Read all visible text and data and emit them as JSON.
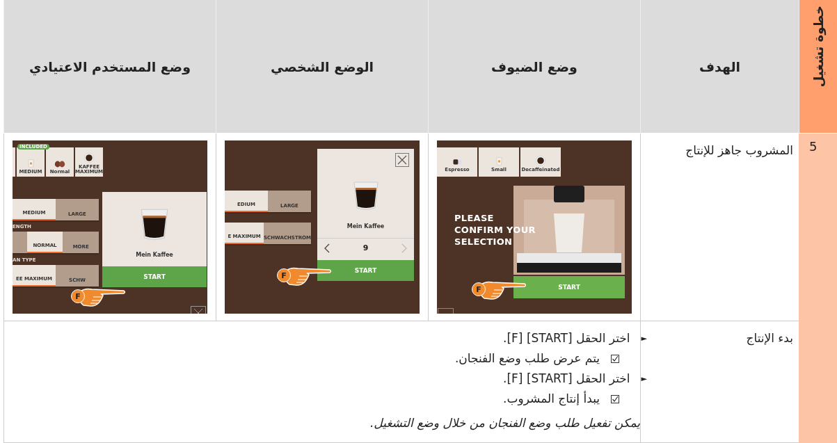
{
  "table": {
    "header": {
      "step": "خطوة تشغيل",
      "goal": "الهدف",
      "modes": [
        "وضع الضيوف",
        "الوضع الشخصي",
        "وضع المستخدم الاعتيادي"
      ]
    },
    "rows": [
      {
        "kind": "screens",
        "step": "5",
        "goal": "المشروب جاهز للإنتاج",
        "screens": [
          {
            "kind": "guest",
            "tiles": [
              {
                "label": "Espresso"
              },
              {
                "label": "Small"
              },
              {
                "label": "Decaffeinated"
              }
            ],
            "prompt": [
              "PLEASE",
              "CONFIRM YOUR",
              "SELECTION"
            ],
            "button": "START",
            "badge": "F"
          },
          {
            "kind": "personal",
            "groups": [
              {
                "options": [
                  {
                    "label": "EDIUM",
                    "selected": true
                  },
                  {
                    "label": "LARGE",
                    "selected": false
                  }
                ]
              },
              {
                "options": [
                  {
                    "label": "E MAXIMUM",
                    "selected": true
                  },
                  {
                    "label": "SCHWACHSTROM",
                    "selected": false
                  }
                ]
              }
            ],
            "product": "Mein Kaffee",
            "counter": "9",
            "button": "START",
            "badge": "F"
          },
          {
            "kind": "standard",
            "tag": "INCLUDED",
            "tiles": [
              {
                "label": "MEDIUM"
              },
              {
                "label": "Normal"
              },
              {
                "label": "KAFFEE MAXIMUM"
              }
            ],
            "groups": [
              {
                "options": [
                  {
                    "label": "MEDIUM",
                    "selected": true
                  },
                  {
                    "label": "LARGE",
                    "selected": false
                  }
                ]
              },
              {
                "title": "ENGTH",
                "options": [
                  {
                    "selected": false
                  },
                  {
                    "label": "NORMAL",
                    "selected": true
                  },
                  {
                    "label": "MORE",
                    "selected": false
                  }
                ]
              },
              {
                "title": "AN TYPE",
                "options": [
                  {
                    "label": "EE MAXIMUM",
                    "selected": true
                  },
                  {
                    "label": "SCHW",
                    "selected": false
                  }
                ]
              }
            ],
            "product": "Mein Kaffee",
            "button": "START",
            "badge": "F"
          }
        ]
      },
      {
        "kind": "steps",
        "goal": "بدء الإنتاج",
        "items": [
          {
            "kind": "action",
            "marker": "►",
            "text": "اختر الحقل [START] [F]."
          },
          {
            "kind": "result",
            "checked": true,
            "text": "يتم عرض طلب وضع الفنجان."
          },
          {
            "kind": "action",
            "marker": "►",
            "text": "اختر الحقل [START] [F]."
          },
          {
            "kind": "result",
            "checked": true,
            "text": "يبدأ إنتاج المشروب."
          }
        ],
        "note": "يمكن تفعيل طلب وضع الفنجان من خلال وضع التشغيل."
      }
    ]
  }
}
